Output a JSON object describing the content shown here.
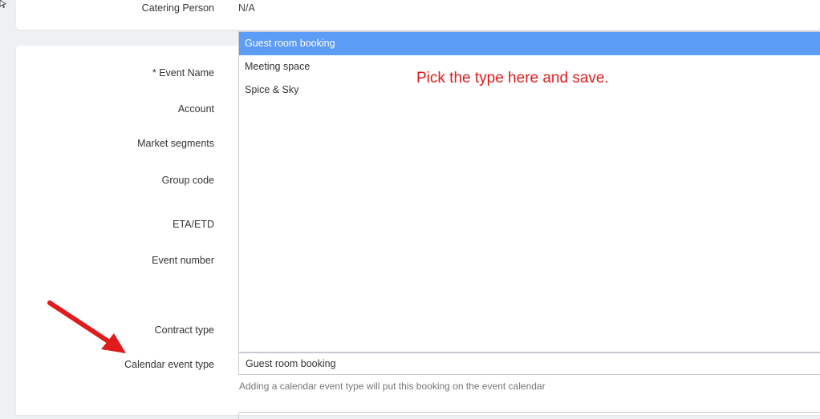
{
  "top_card": {
    "catering_label": "Catering Person",
    "catering_value": "N/A"
  },
  "form": {
    "labels": {
      "event_name": "* Event Name",
      "account": "Account",
      "market_segments": "Market segments",
      "group_code": "Group code",
      "eta_etd": "ETA/ETD",
      "event_number": "Event number",
      "contract_type": "Contract type",
      "calendar_event_type": "Calendar event type"
    },
    "dropdown_options": [
      "Guest room booking",
      "Meeting space",
      "Spice & Sky"
    ],
    "selected_option": "Guest room booking",
    "select_value": "Guest room booking",
    "help_text": "Adding a calendar event type will put this booking on the event calendar"
  },
  "annotation": {
    "text": "Pick the type here and save.",
    "color": "#e01b1b"
  },
  "colors": {
    "highlight": "#5b9cf6",
    "background": "#eef0f3"
  }
}
